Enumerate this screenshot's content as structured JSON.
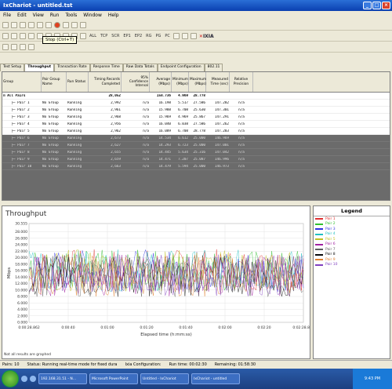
{
  "window": {
    "title": "IxChariot - untitled.tst"
  },
  "menu": [
    "File",
    "Edit",
    "View",
    "Run",
    "Tools",
    "Window",
    "Help"
  ],
  "toolbar2": {
    "items": [
      "ALL",
      "TCP",
      "SCR",
      "EP1",
      "EP2",
      "RG",
      "PG",
      "PC"
    ],
    "brand": "IXIA"
  },
  "tooltip": "Stop (Ctrl+T)",
  "tabs": [
    "Test Setup",
    "Throughput",
    "Transaction Rate",
    "Response Time",
    "Raw Data Totals",
    "Endpoint Configuration",
    "802.11"
  ],
  "grid": {
    "headers": [
      "Group",
      "Pair Group Name",
      "Run Status",
      "Timing Records Completed",
      "95% Confidence Interval",
      "Average (Mbps)",
      "Minimum (Mbps)",
      "Maximum (Mbps)",
      "Measured Time (sec)",
      "Relative Precision"
    ],
    "all_pairs": {
      "label": "All Pairs",
      "records": "28,052",
      "average": "158.736",
      "minimum": "4.969",
      "maximum": "28.778"
    },
    "rows": [
      {
        "pair": "Pair 1",
        "group": "No Group",
        "status": "Running",
        "records": "2,992",
        "ci": "n/a",
        "avg": "16.198",
        "min": "5.517",
        "max": "27.586",
        "time": "147.282",
        "rp": "n/a"
      },
      {
        "pair": "Pair 2",
        "group": "No Group",
        "status": "Running",
        "records": "2,961",
        "ci": "n/a",
        "avg": "15.988",
        "min": "6.708",
        "max": "25.630",
        "time": "147.301",
        "rp": "n/a"
      },
      {
        "pair": "Pair 3",
        "group": "No Group",
        "status": "Running",
        "records": "2,968",
        "ci": "n/a",
        "avg": "15.969",
        "min": "4.969",
        "max": "25.867",
        "time": "147.291",
        "rp": "n/a"
      },
      {
        "pair": "Pair 4",
        "group": "No Group",
        "status": "Running",
        "records": "2,956",
        "ci": "n/a",
        "avg": "16.040",
        "min": "6.038",
        "max": "27.586",
        "time": "147.262",
        "rp": "n/a"
      },
      {
        "pair": "Pair 5",
        "group": "No Group",
        "status": "Running",
        "records": "2,962",
        "ci": "n/a",
        "avg": "16.089",
        "min": "6.708",
        "max": "28.778",
        "time": "147.283",
        "rp": "n/a"
      },
      {
        "pair": "Pair 6",
        "group": "No Group",
        "status": "Running",
        "records": "2,673",
        "ci": "n/a",
        "avg": "14.534",
        "min": "6.612",
        "max": "25.000",
        "time": "146.969",
        "rp": "n/a"
      },
      {
        "pair": "Pair 7",
        "group": "No Group",
        "status": "Running",
        "records": "2,627",
        "ci": "n/a",
        "avg": "14.293",
        "min": "6.723",
        "max": "25.000",
        "time": "147.001",
        "rp": "n/a"
      },
      {
        "pair": "Pair 8",
        "group": "No Group",
        "status": "Running",
        "records": "2,655",
        "ci": "n/a",
        "avg": "14.445",
        "min": "5.634",
        "max": "25.316",
        "time": "147.042",
        "rp": "n/a"
      },
      {
        "pair": "Pair 9",
        "group": "No Group",
        "status": "Running",
        "records": "2,659",
        "ci": "n/a",
        "avg": "14.471",
        "min": "7.207",
        "max": "25.087",
        "time": "146.996",
        "rp": "n/a"
      },
      {
        "pair": "Pair 10",
        "group": "No Group",
        "status": "Running",
        "records": "2,663",
        "ci": "n/a",
        "avg": "14.479",
        "min": "5.594",
        "max": "25.000",
        "time": "146.973",
        "rp": "n/a"
      }
    ]
  },
  "chart_data": {
    "type": "line",
    "title": "Throughput",
    "xlabel": "Elapsed time (h:mm:ss)",
    "ylabel": "Mbps",
    "ylim": [
      0,
      30.555
    ],
    "yticks": [
      "30.555",
      "28.000",
      "26.000",
      "24.000",
      "22.000",
      "20.000",
      "18.000",
      "16.000",
      "14.000",
      "12.000",
      "10.000",
      "8.000",
      "6.000",
      "4.000",
      "2.000",
      "0.000"
    ],
    "xticks": [
      "0:00:28.862",
      "0:00:40",
      "0:01:00",
      "0:01:20",
      "0:01:40",
      "0:02:00",
      "0:02:20",
      "0:02:28.862"
    ],
    "series_levels": [
      16.2,
      16.0,
      16.0,
      16.0,
      16.1,
      14.5,
      14.3,
      14.4,
      14.5,
      14.5
    ],
    "footnote": "Not all results are graphed",
    "grid": true
  },
  "legend": {
    "title": "Legend",
    "items": [
      {
        "name": "Pair 1",
        "color": "#e03030"
      },
      {
        "name": "Pair 2",
        "color": "#30c030"
      },
      {
        "name": "Pair 3",
        "color": "#3030e0"
      },
      {
        "name": "Pair 4",
        "color": "#20c0c0"
      },
      {
        "name": "Pair 5",
        "color": "#c0c020"
      },
      {
        "name": "Pair 6",
        "color": "#a020a0"
      },
      {
        "name": "Pair 7",
        "color": "#606060"
      },
      {
        "name": "Pair 8",
        "color": "#0a0a0a"
      },
      {
        "name": "Pair 9",
        "color": "#e08030"
      },
      {
        "name": "Pair 10",
        "color": "#8040c0"
      }
    ]
  },
  "status": {
    "pairs": "Pairs: 10",
    "text": "Status: Running real-time mode for fixed dura",
    "ixia": "Ixia Configuration:",
    "run": "Run time: 00:02:30",
    "remaining": "Remaining: 01:58:30"
  },
  "taskbar": {
    "tasks": [
      "192.168.31.51 - N...",
      "Microsoft PowerPoint",
      "Untitled - IxChariot",
      "IxChariot - untitled"
    ],
    "clock": "9:43 PM"
  }
}
